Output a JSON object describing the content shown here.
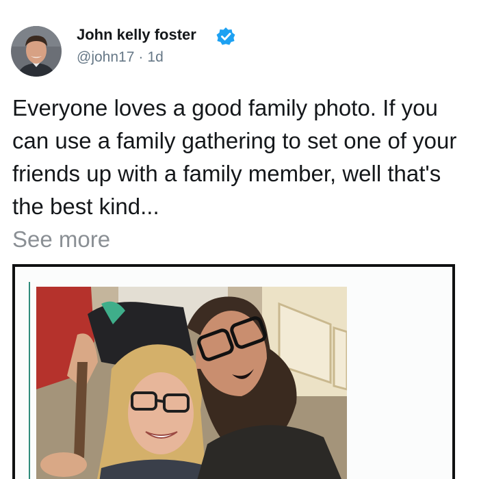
{
  "author": {
    "name": "John kelly foster",
    "handle": "@john17",
    "separator": "·",
    "time": "1d",
    "verified": true
  },
  "tweet": {
    "text": "Everyone loves a good family photo. If you can use a family gathering to set one of your friends up with a family member, well that's the best kind...",
    "see_more": "See more"
  },
  "icons": {
    "verified": "verified-badge-icon"
  },
  "colors": {
    "verified_blue": "#1da1f2",
    "text_primary": "#14171a",
    "text_secondary": "#657786",
    "see_more": "#8a8f94",
    "media_border": "#0f1011"
  }
}
